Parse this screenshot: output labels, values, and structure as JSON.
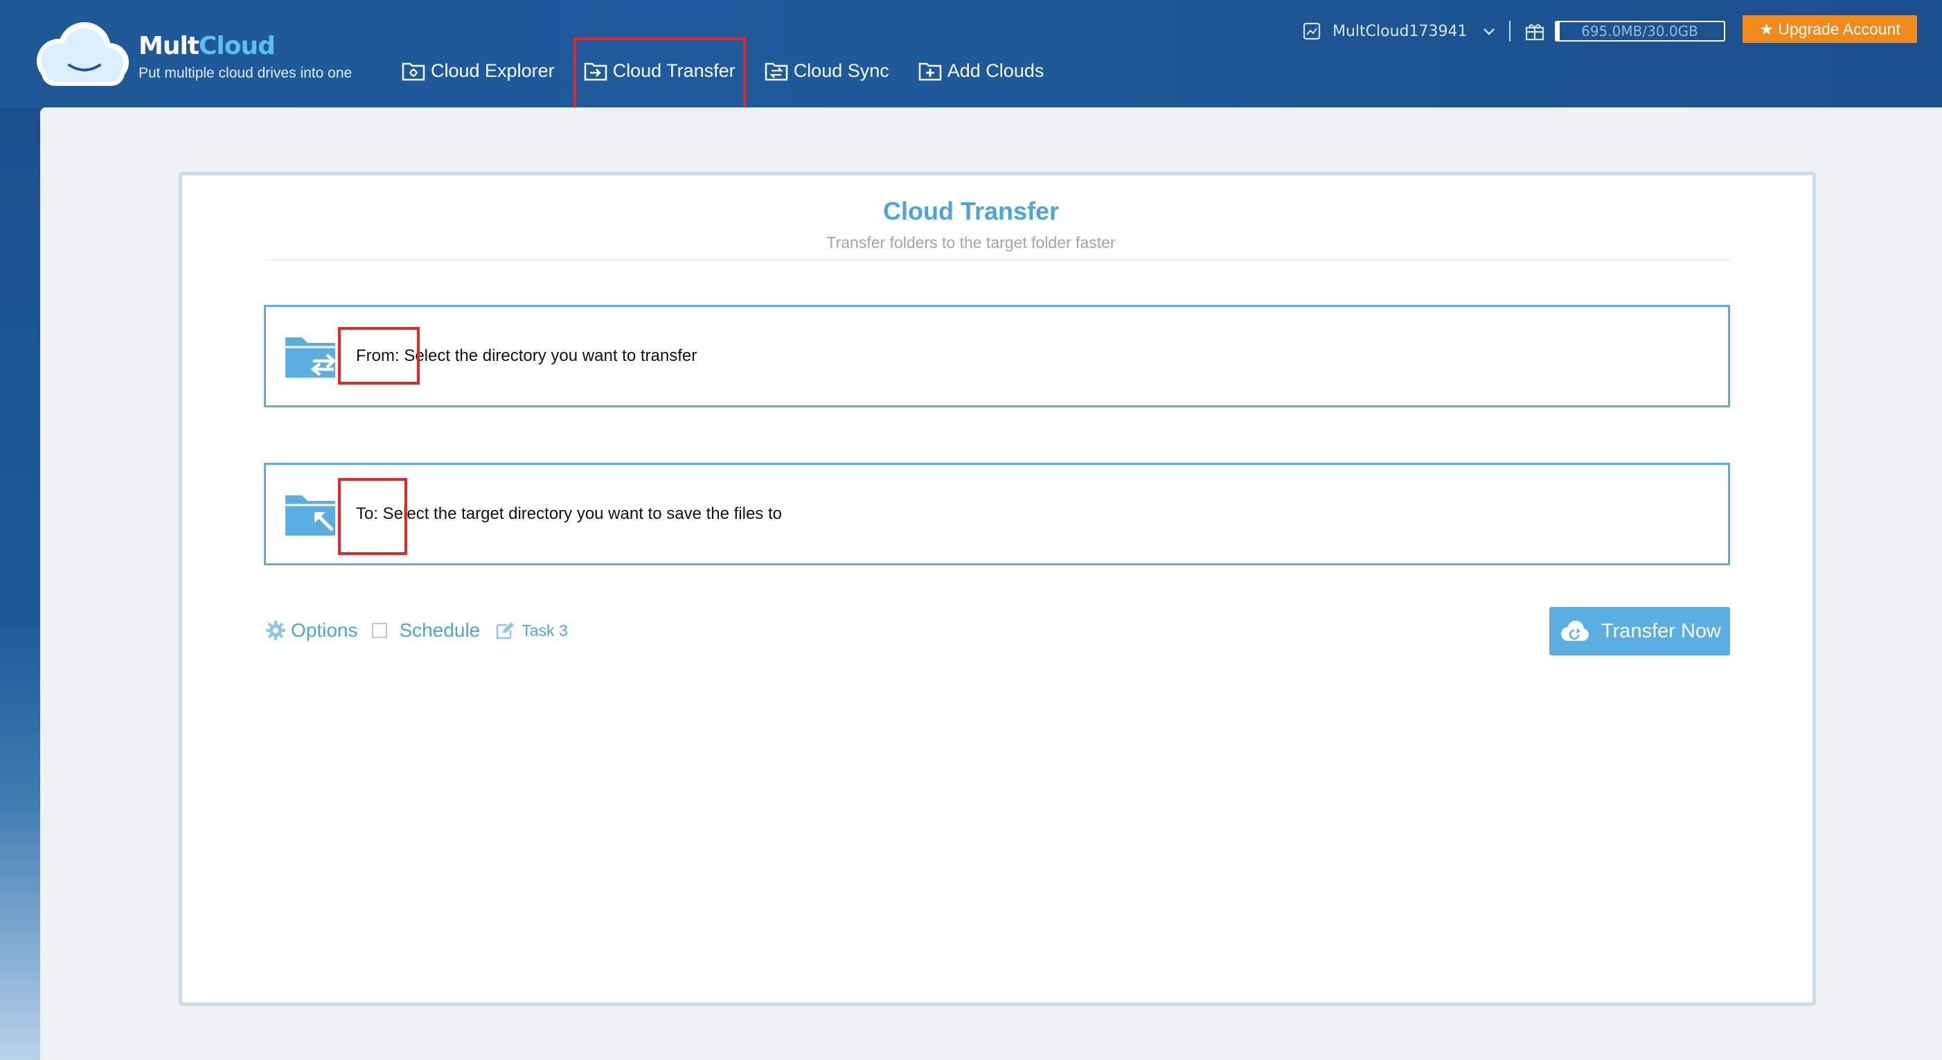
{
  "brand": {
    "name_part1": "Mult",
    "name_part2": "Cloud",
    "tagline": "Put multiple cloud drives into one"
  },
  "nav": {
    "items": [
      {
        "label": "Cloud Explorer",
        "icon": "cloud-explorer-icon"
      },
      {
        "label": "Cloud Transfer",
        "icon": "cloud-transfer-icon",
        "active": true
      },
      {
        "label": "Cloud Sync",
        "icon": "cloud-sync-icon"
      },
      {
        "label": "Add Clouds",
        "icon": "add-clouds-icon"
      }
    ]
  },
  "account": {
    "username": "MultCloud173941",
    "storage_text": "695.0MB/30.0GB",
    "storage_used_fraction": 0.023,
    "upgrade_label": "★ Upgrade Account"
  },
  "card": {
    "title": "Cloud Transfer",
    "subtitle": "Transfer folders to the target folder faster",
    "from_text": "From: Select the directory you want to transfer",
    "to_text": "To: Select the target directory you want to save the files to"
  },
  "options": {
    "options_label": "Options",
    "schedule_label": "Schedule",
    "task_label": "Task 3",
    "schedule_checked": false
  },
  "actions": {
    "transfer_label": "Transfer Now"
  },
  "colors": {
    "header": "#1d5796",
    "accent": "#4aa6d9",
    "upgrade": "#f08a1c",
    "highlight": "#e0282b"
  }
}
